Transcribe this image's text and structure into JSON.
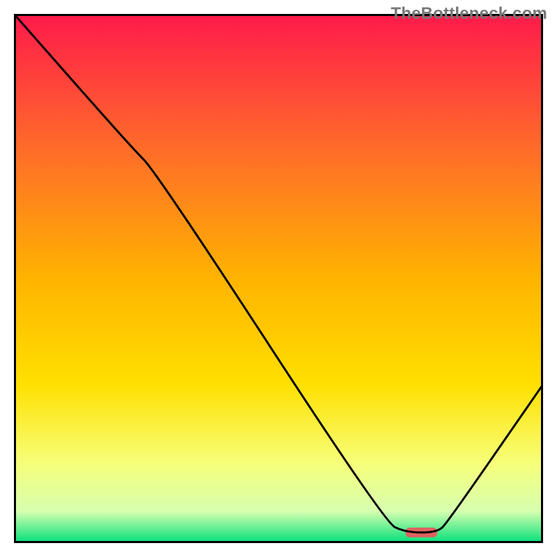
{
  "watermark": "TheBottleneck.com",
  "chart_data": {
    "type": "line",
    "title": "",
    "xlabel": "",
    "ylabel": "",
    "xlim": [
      0,
      100
    ],
    "ylim": [
      0,
      100
    ],
    "grid": false,
    "legend": false,
    "gradient": {
      "top_color": "#ff1a4b",
      "mid_color": "#ffd500",
      "bottom_color": "#00e07a",
      "stops": [
        {
          "offset": 0.0,
          "color": "#ff1a4b"
        },
        {
          "offset": 0.25,
          "color": "#ff6a2a"
        },
        {
          "offset": 0.5,
          "color": "#ffb300"
        },
        {
          "offset": 0.7,
          "color": "#ffe000"
        },
        {
          "offset": 0.85,
          "color": "#f6ff7a"
        },
        {
          "offset": 0.94,
          "color": "#d6ffb0"
        },
        {
          "offset": 1.0,
          "color": "#00e07a"
        }
      ]
    },
    "series": [
      {
        "name": "bottleneck-curve",
        "color": "#000000",
        "x": [
          0,
          22,
          27,
          70,
          74,
          80,
          82,
          100
        ],
        "values": [
          100,
          75,
          70,
          4,
          2,
          2,
          4,
          30
        ]
      }
    ],
    "marker": {
      "name": "optimal-range",
      "color": "#e06060",
      "x_start": 74,
      "x_end": 80,
      "y": 2
    }
  }
}
